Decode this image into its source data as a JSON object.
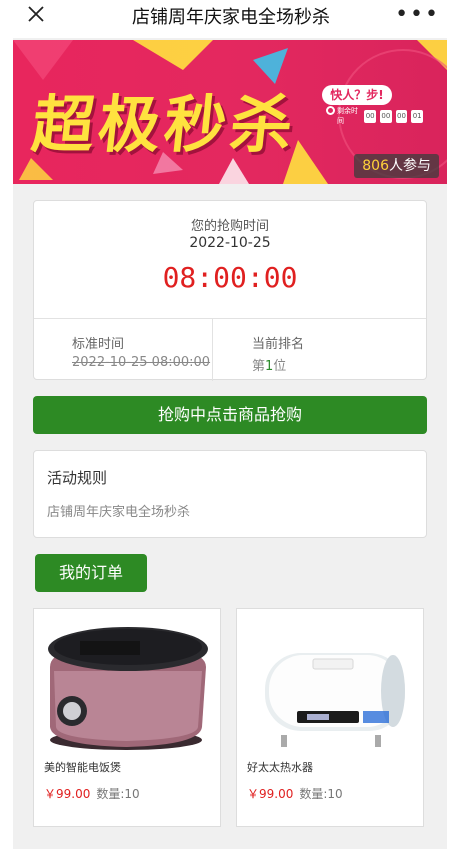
{
  "header": {
    "title": "店铺周年庆家电全场秒杀",
    "more_label": "•••"
  },
  "banner": {
    "headline": "超极秒杀",
    "slogan": "快人？步!",
    "timer_label": "剩余时间",
    "timer_digits": [
      "00",
      "00",
      "00",
      "01"
    ],
    "participants_count": "806",
    "participants_suffix": "人参与"
  },
  "rush": {
    "label": "您的抢购时间",
    "date": "2022-10-25",
    "time": "08:00:00",
    "standard_time_label": "标准时间",
    "standard_time_value": "2022-10-25 08:00:00",
    "rank_label": "当前排名",
    "rank_prefix": "第",
    "rank_number": "1",
    "rank_suffix": "位"
  },
  "buy_button": {
    "label": "抢购中点击商品抢购"
  },
  "rules": {
    "title": "活动规则",
    "text": "店铺周年庆家电全场秒杀"
  },
  "orders_button": {
    "label": "我的订单"
  },
  "products": [
    {
      "name": "美的智能电饭煲",
      "price": "￥99.00",
      "qty": "数量:10",
      "image_icon": "rice-cooker-image"
    },
    {
      "name": "好太太热水器",
      "price": "￥99.00",
      "qty": "数量:10",
      "image_icon": "water-heater-image"
    }
  ],
  "colors": {
    "green": "#2d8a24",
    "red_time": "#e02020",
    "banner_pink": "#e3285f",
    "banner_yellow": "#ffe23f"
  }
}
